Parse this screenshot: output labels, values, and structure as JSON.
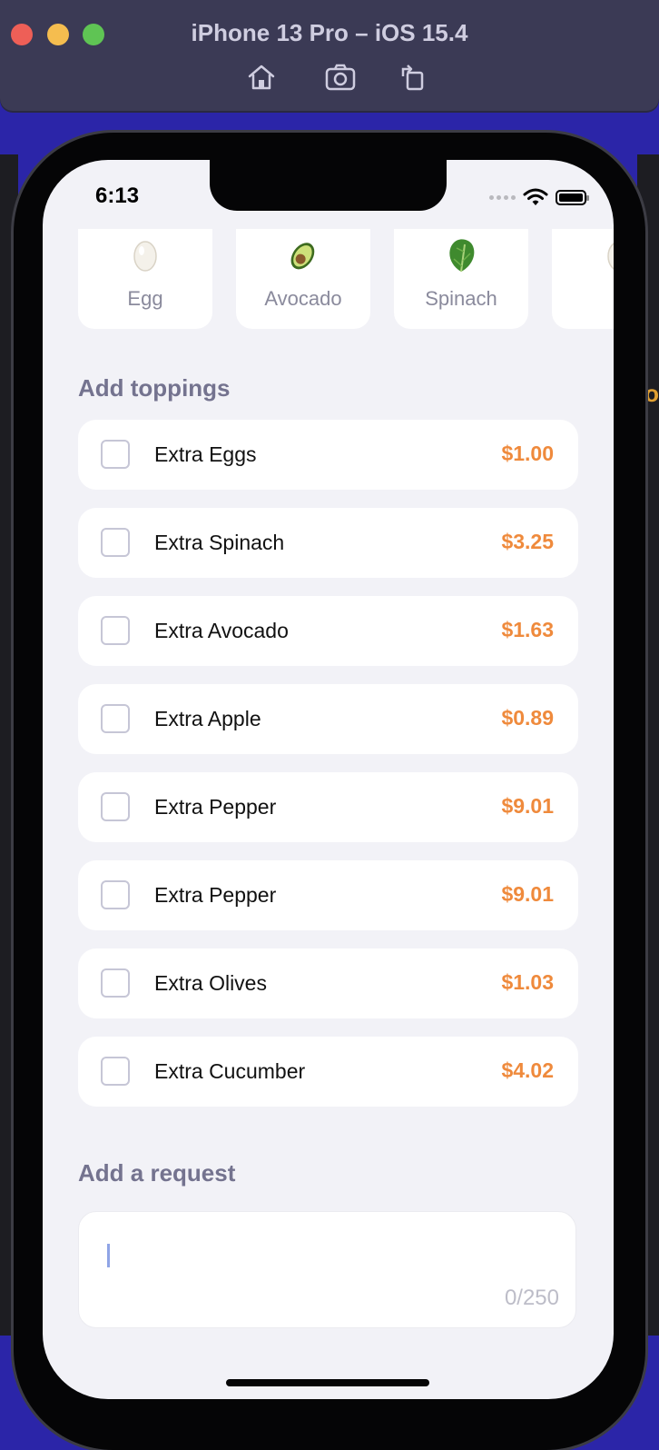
{
  "simulator": {
    "title": "iPhone 13 Pro – iOS 15.4",
    "toolbar_icons": [
      "home-icon",
      "screenshot-icon",
      "rotate-icon"
    ]
  },
  "background_partial_text": "o",
  "status_bar": {
    "time": "6:13"
  },
  "ingredients": [
    {
      "emoji": "egg",
      "label": "Egg"
    },
    {
      "emoji": "avocado",
      "label": "Avocado"
    },
    {
      "emoji": "spinach",
      "label": "Spinach"
    },
    {
      "emoji": "egg",
      "label": "E"
    }
  ],
  "toppings_section": {
    "title": "Add toppings",
    "items": [
      {
        "name": "Extra Eggs",
        "price": "$1.00"
      },
      {
        "name": "Extra Spinach",
        "price": "$3.25"
      },
      {
        "name": "Extra Avocado",
        "price": "$1.63"
      },
      {
        "name": "Extra Apple",
        "price": "$0.89"
      },
      {
        "name": "Extra Pepper",
        "price": "$9.01"
      },
      {
        "name": "Extra Pepper",
        "price": "$9.01"
      },
      {
        "name": "Extra Olives",
        "price": "$1.03"
      },
      {
        "name": "Extra Cucumber",
        "price": "$4.02"
      }
    ]
  },
  "request_section": {
    "title": "Add a request",
    "value": "",
    "counter": "0/250"
  },
  "colors": {
    "accent_price": "#ef8a3c",
    "section_title": "#74738f",
    "screen_background": "#f2f2f7"
  }
}
